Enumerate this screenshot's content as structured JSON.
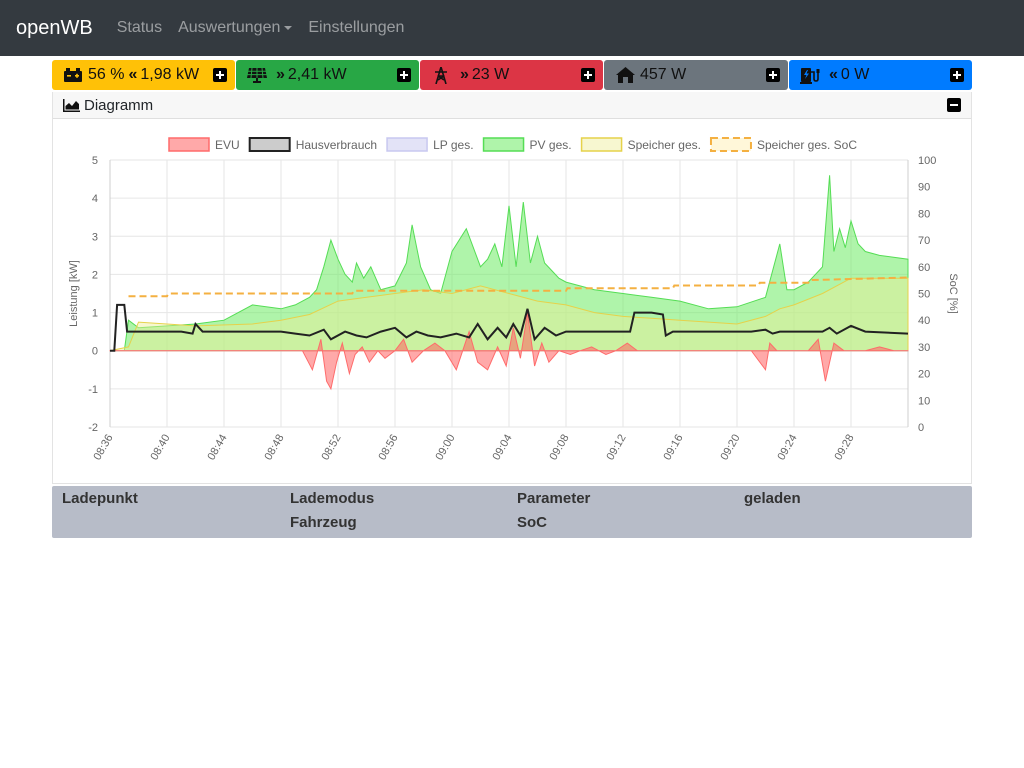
{
  "navbar": {
    "brand": "openWB",
    "links": [
      {
        "label": "Status"
      },
      {
        "label": "Auswertungen"
      },
      {
        "label": "Einstellungen"
      }
    ]
  },
  "tiles": [
    {
      "name": "battery",
      "icon": "car-battery-icon",
      "soc": "56 %",
      "arrow": "«",
      "power": "1,98 kW",
      "color": "#ffc107"
    },
    {
      "name": "pv",
      "icon": "solar-panel-icon",
      "arrow": "»",
      "power": "2,41 kW",
      "color": "#28a745"
    },
    {
      "name": "grid",
      "icon": "power-tower-icon",
      "arrow": "»",
      "power": "23 W",
      "color": "#dc3545"
    },
    {
      "name": "house",
      "icon": "home-icon",
      "power": "457 W",
      "color": "#6c757d"
    },
    {
      "name": "charging",
      "icon": "charging-station-icon",
      "arrow": "«",
      "power": "0 W",
      "color": "#007bff"
    }
  ],
  "diagram": {
    "title": "Diagramm",
    "icon": "area-chart-icon"
  },
  "chart_data": {
    "type": "area",
    "legend_position": "top",
    "grid": true,
    "y_left_label": "Leistung [kW]",
    "y_left_range": [
      -2,
      5
    ],
    "y_left_ticks": [
      "5",
      "4",
      "3",
      "2",
      "1",
      "0",
      "-1",
      "-2"
    ],
    "y_right_label": "SoC [%]",
    "y_right_range": [
      0,
      100
    ],
    "y_right_ticks": [
      "100",
      "90",
      "80",
      "70",
      "60",
      "50",
      "40",
      "30",
      "20",
      "10",
      "0"
    ],
    "x_range_minutes": [
      0,
      56
    ],
    "x_ticks": [
      "08:36",
      "08:40",
      "08:44",
      "08:48",
      "08:52",
      "08:56",
      "09:00",
      "09:04",
      "09:08",
      "09:12",
      "09:16",
      "09:20",
      "09:24",
      "09:28"
    ],
    "series": [
      {
        "name": "EVU",
        "color": "#ff6b6b",
        "fill": "rgba(255,99,99,0.55)",
        "style": "area",
        "x": [
          0,
          13.5,
          14.2,
          14.8,
          15.2,
          15.5,
          15.9,
          16.3,
          16.8,
          17.2,
          17.7,
          18.2,
          18.8,
          19.3,
          20,
          20.6,
          21.2,
          22,
          22.8,
          23.5,
          24.3,
          25.2,
          25.8,
          26.5,
          27.2,
          27.8,
          28.3,
          28.8,
          29.3,
          29.8,
          30.3,
          30.8,
          31.5,
          32.3,
          33,
          33.8,
          34.8,
          35.5,
          36.3,
          37,
          38,
          45,
          46,
          46.3,
          46.8,
          47.5,
          49,
          49.7,
          50.2,
          50.8,
          51.5,
          53,
          54,
          55,
          56
        ],
        "y": [
          0,
          0,
          -0.5,
          0.3,
          -0.8,
          -1.0,
          -0.3,
          0.2,
          -0.6,
          -0.1,
          0.1,
          -0.3,
          0.0,
          -0.2,
          0.0,
          0.3,
          -0.3,
          0.0,
          0.2,
          0.0,
          -0.5,
          0.5,
          -0.3,
          -0.5,
          0.1,
          -0.4,
          0.6,
          -0.2,
          1.0,
          -0.4,
          0.2,
          -0.3,
          0.0,
          -0.1,
          0.0,
          0.1,
          -0.1,
          0.0,
          0.2,
          0.0,
          0.0,
          0.0,
          -0.5,
          0.2,
          0.0,
          0.0,
          0.0,
          0.3,
          -0.8,
          0.2,
          0.0,
          0.0,
          0.1,
          0.0,
          0.0
        ]
      },
      {
        "name": "Hausverbrauch",
        "color": "#222222",
        "style": "line",
        "x": [
          0,
          0.3,
          0.5,
          1,
          1.2,
          5,
          5.8,
          6,
          6.5,
          12,
          13,
          14,
          15,
          15.5,
          16.5,
          17.3,
          18,
          19,
          20,
          20.8,
          21.5,
          22.3,
          23.2,
          24.3,
          25.2,
          25.8,
          26.5,
          27.2,
          27.8,
          28.3,
          28.8,
          29.3,
          29.8,
          30.5,
          31.3,
          32,
          33,
          36.5,
          36.8,
          38,
          38.8,
          39,
          39.5,
          45,
          46,
          46.5,
          47,
          50,
          50.5,
          51,
          52,
          53,
          56
        ],
        "y": [
          0,
          0,
          1.2,
          1.2,
          0.5,
          0.5,
          0.45,
          0.7,
          0.5,
          0.5,
          0.45,
          0.4,
          0.55,
          0.3,
          0.5,
          0.4,
          0.35,
          0.5,
          0.6,
          0.35,
          0.5,
          0.4,
          0.35,
          0.45,
          0.35,
          0.7,
          0.3,
          0.6,
          0.35,
          0.7,
          0.4,
          1.1,
          0.3,
          0.6,
          0.4,
          0.5,
          0.5,
          0.5,
          1.0,
          1.0,
          0.95,
          0.4,
          0.5,
          0.5,
          0.55,
          0.45,
          0.5,
          0.5,
          0.6,
          0.45,
          0.65,
          0.5,
          0.45
        ]
      },
      {
        "name": "LP ges.",
        "color": "#c8c8f0",
        "fill": "rgba(200,200,240,0.5)",
        "style": "area",
        "x": [
          0,
          56
        ],
        "y": [
          0,
          0
        ]
      },
      {
        "name": "PV ges.",
        "color": "#55dd55",
        "fill": "rgba(110,235,100,0.55)",
        "style": "area",
        "x": [
          0,
          1,
          1.3,
          2,
          4,
          6,
          8,
          10,
          12,
          13,
          14,
          14.5,
          15,
          15.5,
          16,
          16.5,
          17,
          17.3,
          17.8,
          18.3,
          19,
          20,
          20.8,
          21.2,
          21.8,
          22.5,
          23.2,
          24,
          25,
          26,
          26.5,
          27,
          27.5,
          28,
          28.5,
          29,
          29.5,
          30,
          30.5,
          31,
          31.5,
          32,
          34,
          36,
          38,
          40,
          42,
          44,
          46,
          47,
          47.5,
          48,
          49,
          50,
          50.5,
          50.8,
          51.2,
          51.6,
          52,
          52.5,
          53,
          54,
          56
        ],
        "y": [
          0,
          0,
          0.8,
          0.6,
          0.65,
          0.7,
          0.8,
          1.2,
          1.1,
          1.2,
          1.4,
          1.6,
          2.2,
          2.9,
          2.4,
          2.0,
          1.8,
          2.3,
          1.9,
          2.2,
          1.6,
          1.7,
          2.3,
          3.3,
          2.2,
          1.6,
          1.5,
          2.6,
          3.2,
          2.2,
          2.4,
          2.8,
          2.2,
          3.8,
          2.2,
          3.9,
          2.3,
          3.0,
          2.3,
          2.1,
          1.9,
          1.8,
          1.6,
          1.5,
          1.4,
          1.3,
          1.1,
          1.15,
          1.4,
          2.8,
          1.6,
          1.6,
          1.8,
          2.2,
          4.6,
          2.6,
          3.2,
          2.7,
          3.4,
          2.8,
          2.6,
          2.5,
          2.4
        ]
      },
      {
        "name": "Speicher ges.",
        "color": "#e6d24a",
        "fill": "rgba(238,238,150,0.45)",
        "style": "area",
        "x": [
          0,
          1.3,
          2,
          6,
          10,
          12,
          14,
          16,
          18,
          20,
          22,
          24,
          26,
          28,
          30,
          32,
          34,
          36,
          38,
          40,
          42,
          44,
          46,
          47,
          48,
          50,
          52,
          54,
          56
        ],
        "y": [
          0,
          0.1,
          0.75,
          0.65,
          0.7,
          0.8,
          0.95,
          1.3,
          1.4,
          1.5,
          1.6,
          1.5,
          1.7,
          1.5,
          1.3,
          1.2,
          1.0,
          0.9,
          0.85,
          0.8,
          0.75,
          0.7,
          0.9,
          1.1,
          1.2,
          1.5,
          1.9,
          1.9,
          1.9
        ]
      },
      {
        "name": "Speicher ges. SoC",
        "color": "#f4b041",
        "style": "dashed",
        "axis": "right",
        "x": [
          1.3,
          4,
          4.1,
          17,
          17.1,
          32,
          32.1,
          39.5,
          39.6,
          45.5,
          45.6,
          49,
          49.1,
          56
        ],
        "y": [
          49,
          49,
          50,
          50,
          51,
          51,
          52,
          52,
          53,
          53,
          54,
          54,
          55,
          56
        ]
      }
    ]
  },
  "table": {
    "headers": [
      {
        "label": "Ladepunkt"
      },
      {
        "label": "Lademodus",
        "sub": "Fahrzeug"
      },
      {
        "label": "Parameter",
        "sub": "SoC"
      },
      {
        "label": "geladen"
      }
    ]
  }
}
